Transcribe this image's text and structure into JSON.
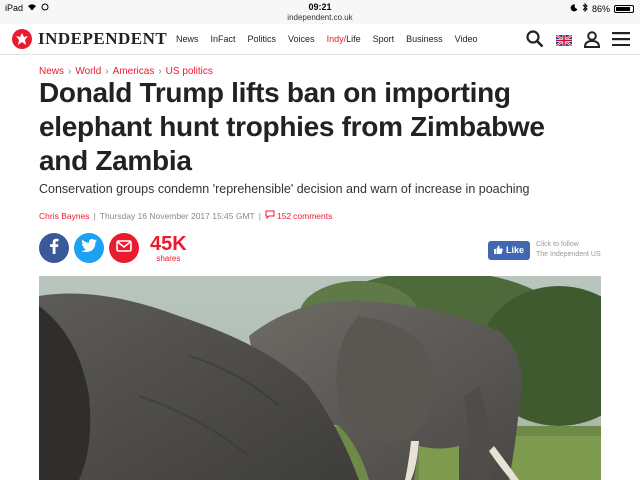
{
  "status_bar": {
    "device": "iPad",
    "time": "09:21",
    "url": "independent.co.uk",
    "battery": "86%",
    "battery_level": 0.86
  },
  "header": {
    "logo": "INDEPENDENT",
    "nav": {
      "news": "News",
      "infact": "InFact",
      "politics": "Politics",
      "voices": "Voices",
      "indy": "Indy",
      "slash": "/",
      "life": "Life",
      "sport": "Sport",
      "business": "Business",
      "video": "Video"
    }
  },
  "article": {
    "breadcrumb": [
      "News",
      "World",
      "Americas",
      "US politics"
    ],
    "breadcrumb_sep": "›",
    "headline": "Donald Trump lifts ban on importing elephant hunt trophies from Zimbabwe and Zambia",
    "standfirst": "Conservation groups condemn 'reprehensible' decision and warn of increase in poaching",
    "author": "Chris Baynes",
    "divider": "|",
    "date": "Thursday 16 November 2017 15:45 GMT",
    "comment_count": "152",
    "comment_label": "comments",
    "share_count": "45K",
    "share_label": "shares",
    "like_label": "Like",
    "follow_line1": "Click to follow",
    "follow_line2": "The Independent US"
  }
}
